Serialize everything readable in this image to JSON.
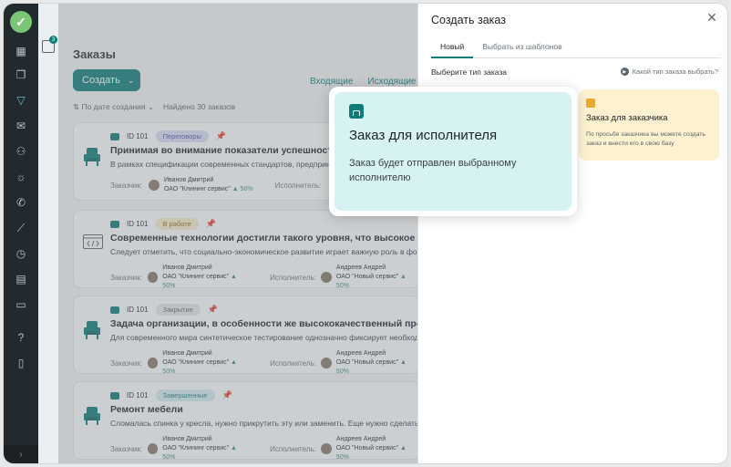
{
  "rail": {
    "icons": [
      "dashboard-icon",
      "documents-icon",
      "filter-icon",
      "mail-icon",
      "users-icon",
      "idea-icon",
      "phone-icon",
      "chart-icon",
      "timer-icon",
      "calendar-icon",
      "folder-icon",
      "help-icon",
      "mobile-icon"
    ],
    "active": "filter-icon",
    "collapse": "›"
  },
  "col2": {
    "badge": "3"
  },
  "main": {
    "title": "Заказы",
    "create_label": "Создать",
    "tabs": [
      "Входящие",
      "Исходящие"
    ],
    "sort_label": "По дате создания",
    "found_label": "Найдено 30 заказов",
    "cards": [
      {
        "id": "ID 101",
        "status": "Переговоры",
        "status_bg": "#dcdff7",
        "status_color": "#4a55a8",
        "title": "Принимая во внимание показатели успешности, пов",
        "desc": "В рамках спецификации современных стандартов, предприни",
        "customer_label": "Заказчик:",
        "customer_name": "Иванов Дмитрий",
        "customer_org": "ОАО \"Клининг сервис\"",
        "customer_rate": "50%",
        "executor_label": "Исполнитель:",
        "executor_name": "",
        "executor_org": "",
        "executor_rate": "",
        "thumb": "armchair"
      },
      {
        "id": "ID 101",
        "status": "В работе",
        "status_bg": "#fbeccb",
        "status_color": "#9a6a10",
        "title": "Современные технологии достигли такого уровня, что высокое качество п",
        "desc": "Следует отметить, что социально-экономическое развитие играет важную роль в форм",
        "customer_label": "Заказчик:",
        "customer_name": "Иванов Дмитрий",
        "customer_org": "ОАО \"Клининг сервис\"",
        "customer_rate": "50%",
        "executor_label": "Исполнитель:",
        "executor_name": "Андреев Андрей",
        "executor_org": "ОАО \"Новый сервис\"",
        "executor_rate": "50%",
        "thumb": "code"
      },
      {
        "id": "ID 101",
        "status": "Закрытие",
        "status_bg": "#e6e8ea",
        "status_color": "#5c666e",
        "title": "Задача организации, в особенности же высококачественный прототип бу",
        "desc": "Для современного мира синтетическое тестирование однозначно фиксирует необходим",
        "customer_label": "Заказчик:",
        "customer_name": "Иванов Дмитрий",
        "customer_org": "ОАО \"Клининг сервис\"",
        "customer_rate": "50%",
        "executor_label": "Исполнитель:",
        "executor_name": "Андреев Андрей",
        "executor_org": "ОАО \"Новый сервис\"",
        "executor_rate": "50%",
        "thumb": "armchair"
      },
      {
        "id": "ID 101",
        "status": "Завершенные",
        "status_bg": "#d3eef0",
        "status_color": "#2b7c84",
        "title": "Ремонт мебели",
        "desc": "Сломалась спинка у кресла, нужно прикрутить эту или заменить. Еще нужно сделать спин",
        "customer_label": "Заказчик:",
        "customer_name": "Иванов Дмитрий",
        "customer_org": "ОАО \"Клининг сервис\"",
        "customer_rate": "50%",
        "executor_label": "Исполнитель:",
        "executor_name": "Андреев Андрей",
        "executor_org": "ОАО \"Новый сервис\"",
        "executor_rate": "50%",
        "thumb": "armchair"
      }
    ]
  },
  "panel": {
    "title": "Создать заказ",
    "tabs": [
      "Новый",
      "Выбрать из шаблонов"
    ],
    "active_tab": 0,
    "choose_label": "Выберите тип заказа",
    "help_link": "Какой тип заказа выбрать?",
    "executor_card": {
      "title": "Заказ для исполнителя",
      "desc": "Заказ будет отправлен выбранному исполнителю"
    },
    "customer_card": {
      "title": "Заказ для заказчика",
      "desc": "По просьбе заказчика вы можете создать заказ и внести его в свою базу"
    }
  },
  "colors": {
    "accent": "#0d7d7a",
    "rail": "#232a2f",
    "selected_card": "#d6f2f2",
    "customer_card": "#fdf1cf"
  }
}
